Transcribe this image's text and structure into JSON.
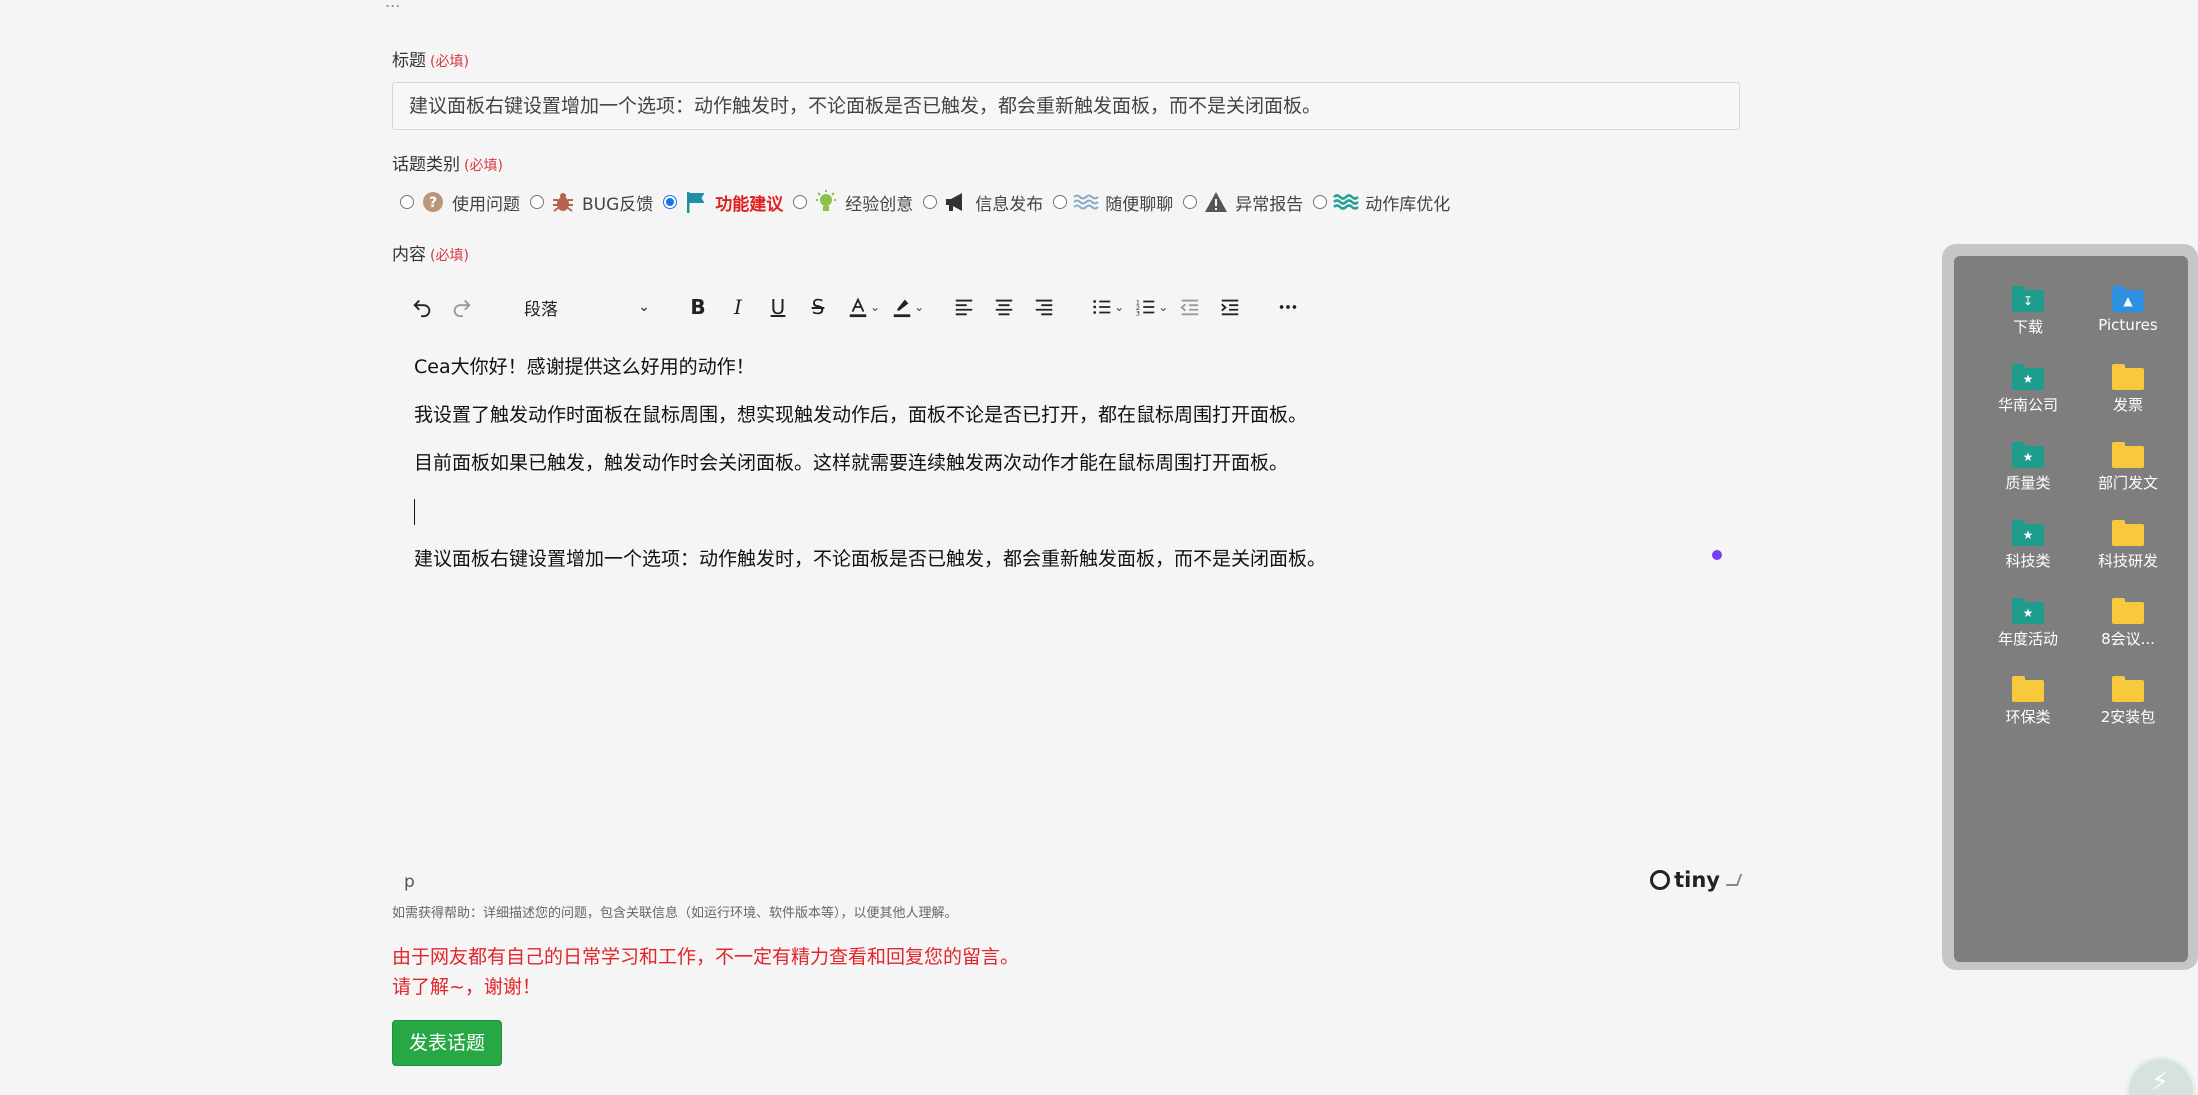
{
  "top_crumb": "...",
  "title_field": {
    "label": "标题",
    "required": "(必填)",
    "value": "建议面板右键设置增加一个选项：动作触发时，不论面板是否已触发，都会重新触发面板，而不是关闭面板。"
  },
  "category_field": {
    "label": "话题类别",
    "required": "(必填)",
    "options": [
      {
        "label": "使用问题",
        "icon": "question-circle-icon",
        "selected": false
      },
      {
        "label": "BUG反馈",
        "icon": "bug-icon",
        "selected": false
      },
      {
        "label": "功能建议",
        "icon": "flag-icon",
        "selected": true
      },
      {
        "label": "经验创意",
        "icon": "lightbulb-icon",
        "selected": false
      },
      {
        "label": "信息发布",
        "icon": "megaphone-icon",
        "selected": false
      },
      {
        "label": "随便聊聊",
        "icon": "wave-icon",
        "selected": false
      },
      {
        "label": "异常报告",
        "icon": "warning-icon",
        "selected": false
      },
      {
        "label": "动作库优化",
        "icon": "water-icon",
        "selected": false
      }
    ]
  },
  "content_field": {
    "label": "内容",
    "required": "(必填)"
  },
  "editor": {
    "block_format": "段落",
    "paragraphs": [
      "Cea大你好！感谢提供这么好用的动作！",
      "我设置了触发动作时面板在鼠标周围，想实现触发动作后，面板不论是否已打开，都在鼠标周围打开面板。",
      "目前面板如果已触发，触发动作时会关闭面板。这样就需要连续触发两次动作才能在鼠标周围打开面板。",
      "",
      "建议面板右键设置增加一个选项：动作触发时，不论面板是否已触发，都会重新触发面板，而不是关闭面板。"
    ],
    "status_path": "p",
    "brand": "tiny"
  },
  "help_text": "如需获得帮助：详细描述您的问题，包含关联信息（如运行环境、软件版本等），以便其他人理解。",
  "warning_lines": [
    "由于网友都有自己的日常学习和工作，不一定有精力查看和回复您的留言。",
    "请了解~，谢谢！"
  ],
  "submit_label": "发表话题",
  "desktop_panel": {
    "items": [
      {
        "label": "下载",
        "color": "teal",
        "icon": "download-folder-icon"
      },
      {
        "label": "Pictures",
        "color": "blue",
        "icon": "pictures-folder-icon"
      },
      {
        "label": "华南公司",
        "color": "teal",
        "icon": "folder-icon"
      },
      {
        "label": "发票",
        "color": "yellow",
        "icon": "folder-icon"
      },
      {
        "label": "质量类",
        "color": "teal",
        "icon": "folder-icon"
      },
      {
        "label": "部门发文",
        "color": "yellow",
        "icon": "folder-icon"
      },
      {
        "label": "科技类",
        "color": "teal",
        "icon": "folder-icon"
      },
      {
        "label": "科技研发",
        "color": "yellow",
        "icon": "folder-icon"
      },
      {
        "label": "年度活动",
        "color": "teal",
        "icon": "folder-icon"
      },
      {
        "label": "8会议...",
        "color": "yellow",
        "icon": "folder-icon"
      },
      {
        "label": "环保类",
        "color": "yellow",
        "icon": "folder-icon"
      },
      {
        "label": "2安装包",
        "color": "yellow",
        "icon": "folder-icon"
      }
    ]
  },
  "colors": {
    "required": "#d9363e",
    "active_category": "#e02020",
    "warning": "#e0262a",
    "submit": "#28a745"
  }
}
